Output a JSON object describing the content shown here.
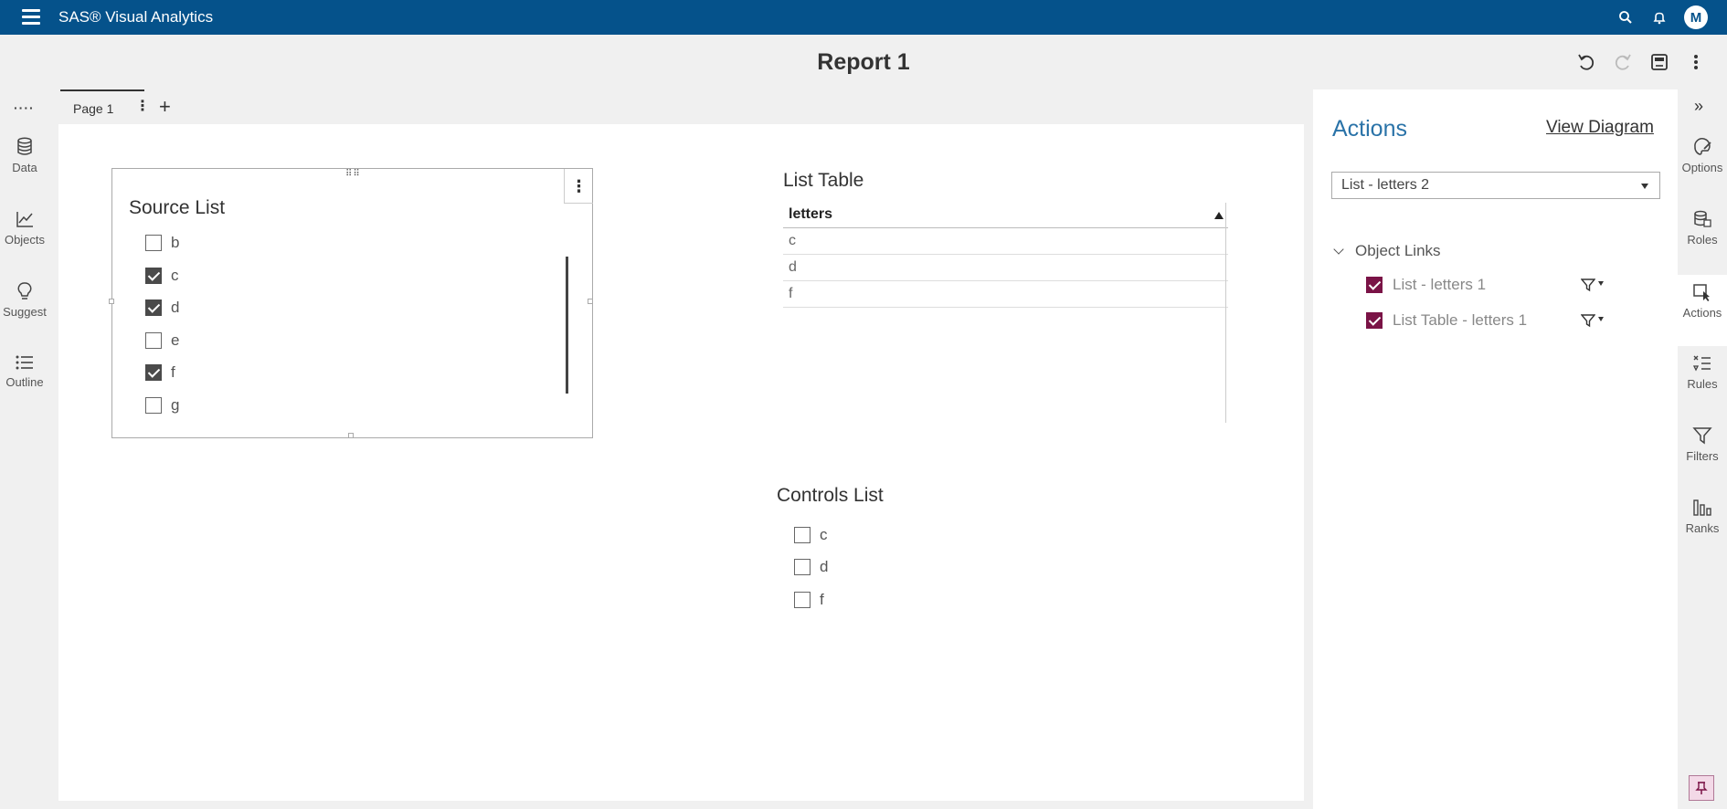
{
  "app": {
    "title": "SAS® Visual Analytics",
    "user_initial": "M"
  },
  "report": {
    "title": "Report 1"
  },
  "left_rail": {
    "items": [
      {
        "label": "Data",
        "icon": "database-icon"
      },
      {
        "label": "Objects",
        "icon": "line-chart-icon"
      },
      {
        "label": "Suggest",
        "icon": "lightbulb-icon"
      },
      {
        "label": "Outline",
        "icon": "list-icon"
      }
    ]
  },
  "page_tabs": {
    "tabs": [
      {
        "label": "Page 1"
      }
    ]
  },
  "source_list": {
    "title": "Source List",
    "items": [
      {
        "label": "b",
        "checked": false
      },
      {
        "label": "c",
        "checked": true
      },
      {
        "label": "d",
        "checked": true
      },
      {
        "label": "e",
        "checked": false
      },
      {
        "label": "f",
        "checked": true
      },
      {
        "label": "g",
        "checked": false
      }
    ]
  },
  "list_table": {
    "title": "List Table",
    "column": "letters",
    "rows": [
      "c",
      "d",
      "f"
    ]
  },
  "controls_list": {
    "title": "Controls List",
    "items": [
      {
        "label": "c",
        "checked": false
      },
      {
        "label": "d",
        "checked": false
      },
      {
        "label": "f",
        "checked": false
      }
    ]
  },
  "actions_panel": {
    "title": "Actions",
    "view_diagram": "View Diagram",
    "selected_object": "List - letters 2",
    "section": "Object Links",
    "links": [
      {
        "label": "List - letters 1",
        "checked": true
      },
      {
        "label": "List Table - letters 1",
        "checked": true
      }
    ]
  },
  "right_rail": {
    "items": [
      {
        "label": "Options",
        "icon": "paint-brush-icon"
      },
      {
        "label": "Roles",
        "icon": "roles-icon"
      },
      {
        "label": "Actions",
        "icon": "actions-icon",
        "active": true
      },
      {
        "label": "Rules",
        "icon": "rules-icon"
      },
      {
        "label": "Filters",
        "icon": "filter-icon"
      },
      {
        "label": "Ranks",
        "icon": "ranks-icon"
      }
    ]
  },
  "colors": {
    "brand": "#05528b",
    "accent_maroon": "#7a1346",
    "actions_title": "#2a73a8"
  }
}
